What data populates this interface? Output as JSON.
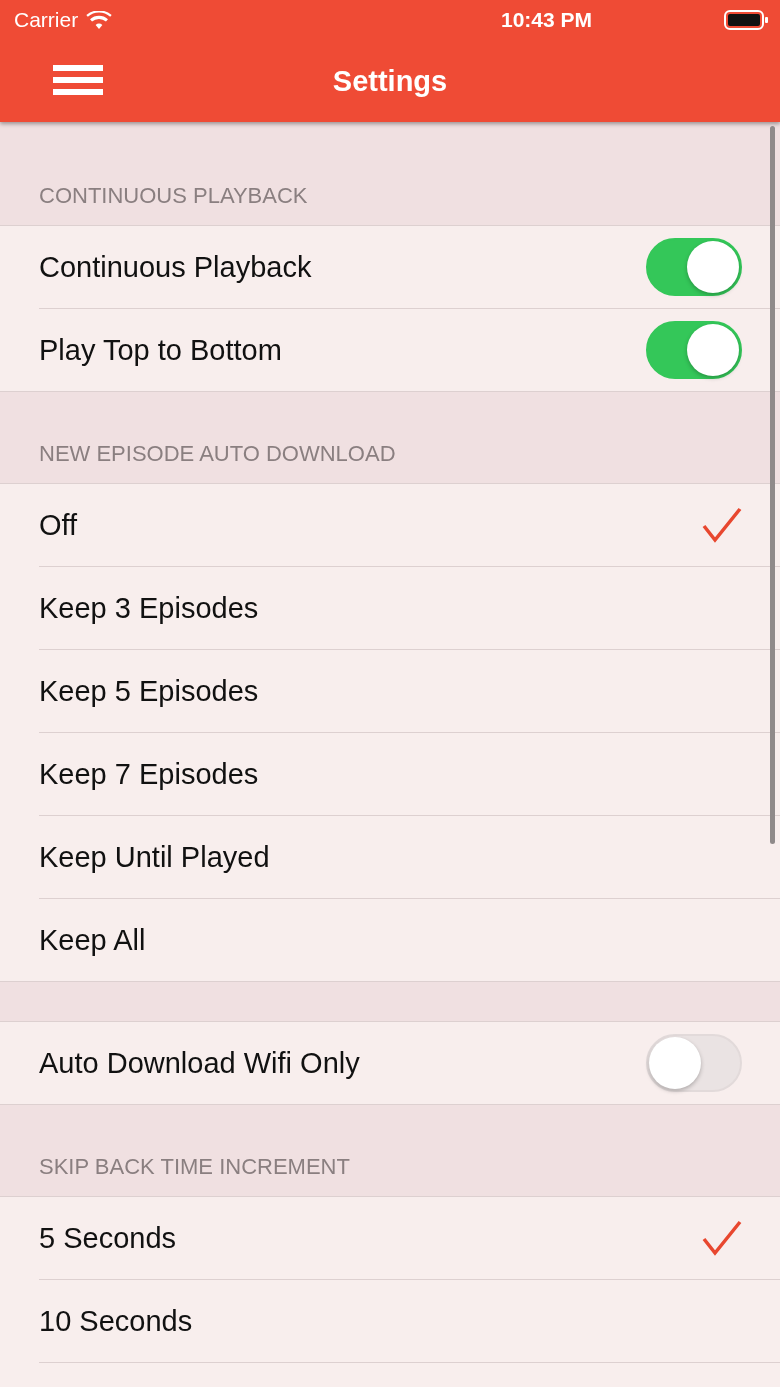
{
  "status_bar": {
    "carrier": "Carrier",
    "time": "10:43 PM"
  },
  "nav_bar": {
    "title": "Settings"
  },
  "sections": [
    {
      "header": "CONTINUOUS PLAYBACK",
      "rows": [
        {
          "kind": "toggle",
          "label": "Continuous Playback",
          "on": true
        },
        {
          "kind": "toggle",
          "label": "Play Top to Bottom",
          "on": true
        }
      ]
    },
    {
      "header": "NEW EPISODE AUTO DOWNLOAD",
      "rows": [
        {
          "kind": "option",
          "label": "Off",
          "selected": true
        },
        {
          "kind": "option",
          "label": "Keep 3 Episodes",
          "selected": false
        },
        {
          "kind": "option",
          "label": "Keep 5 Episodes",
          "selected": false
        },
        {
          "kind": "option",
          "label": "Keep 7 Episodes",
          "selected": false
        },
        {
          "kind": "option",
          "label": "Keep Until Played",
          "selected": false
        },
        {
          "kind": "option",
          "label": "Keep All",
          "selected": false
        }
      ]
    },
    {
      "rows": [
        {
          "kind": "toggle",
          "label": "Auto Download Wifi Only",
          "on": false
        }
      ]
    },
    {
      "header": "SKIP BACK TIME INCREMENT",
      "rows": [
        {
          "kind": "option",
          "label": "5 Seconds",
          "selected": true
        },
        {
          "kind": "option",
          "label": "10 Seconds",
          "selected": false
        }
      ]
    }
  ]
}
